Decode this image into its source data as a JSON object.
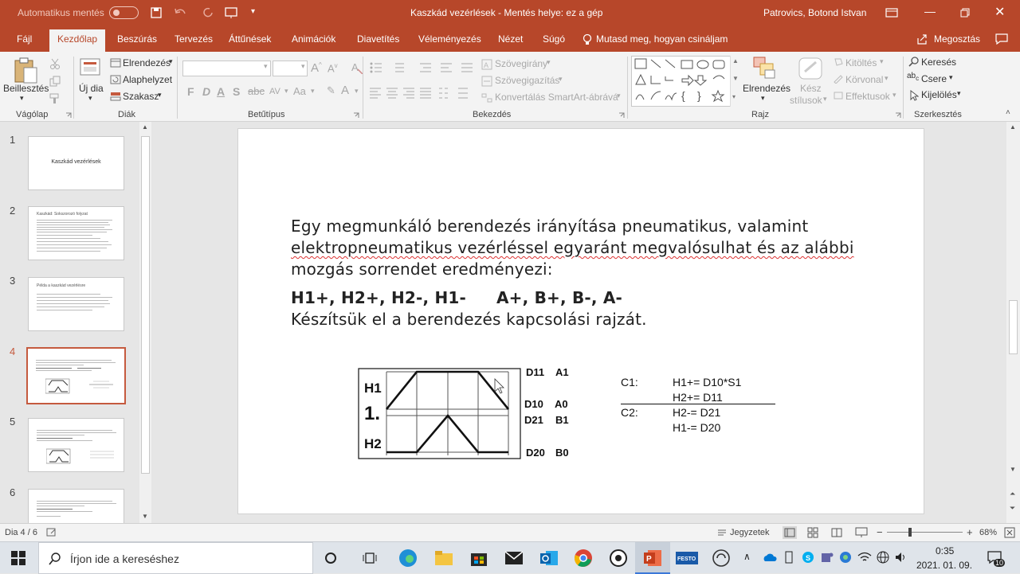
{
  "title_bar": {
    "autosave_label": "Automatikus mentés",
    "autosave_state": "Ki",
    "document_title": "Kaszkád vezérlések  -  Mentés helye: ez a gép",
    "user_name": "Patrovics, Botond Istvan"
  },
  "ribbon_tabs": [
    "Fájl",
    "Kezdőlap",
    "Beszúrás",
    "Tervezés",
    "Áttűnések",
    "Animációk",
    "Diavetítés",
    "Véleményezés",
    "Nézet",
    "Súgó"
  ],
  "tell_me": "Mutasd meg, hogyan csináljam",
  "share_label": "Megosztás",
  "ribbon": {
    "clipboard": {
      "paste": "Beillesztés",
      "group": "Vágólap"
    },
    "slides": {
      "new_slide": "Új dia",
      "layout": "Elrendezés",
      "reset": "Alaphelyzet",
      "section": "Szakasz",
      "group": "Diák"
    },
    "font": {
      "bold": "F",
      "italic": "D",
      "underline": "A",
      "strike": "S",
      "group": "Betűtípus"
    },
    "paragraph": {
      "text_direction": "Szövegirány",
      "align_text": "Szövegigazítás",
      "smartart": "Konvertálás SmartArt-ábrává",
      "group": "Bekezdés"
    },
    "drawing": {
      "arrange": "Elrendezés",
      "quick_styles_1": "Kész",
      "quick_styles_2": "stílusok",
      "fill": "Kitöltés",
      "outline": "Körvonal",
      "effects": "Effektusok",
      "group": "Rajz"
    },
    "editing": {
      "find": "Keresés",
      "replace": "Csere",
      "select": "Kijelölés",
      "group": "Szerkesztés"
    }
  },
  "thumbnails": [
    {
      "num": "1",
      "title": "Kaszkád vezérlések"
    },
    {
      "num": "2",
      "title": "Kaszkád: Sokszorozó folyzat"
    },
    {
      "num": "3",
      "title": "Példa a kaszkád vezérlésre"
    },
    {
      "num": "4",
      "title": ""
    },
    {
      "num": "5",
      "title": ""
    },
    {
      "num": "6",
      "title": ""
    }
  ],
  "slide": {
    "para_line1": "Egy megmunkáló berendezés irányítása pneumatikus, valamint",
    "para_line2": "elektropneumatikus vezérléssel egyaránt megvalósulhat és az alábbi",
    "para_line3": "mozgás sorrendet eredményezi:",
    "sequence_h": "H1+, H2+, H2-, H1-",
    "sequence_ab": "A+, B+, B-, A-",
    "task_line": "Készítsük el a berendezés kapcsolási rajzát.",
    "diagram": {
      "h1": "H1",
      "one": "1.",
      "h2": "H2",
      "d11": "D11",
      "a1": "A1",
      "d10": "D10",
      "a0": "A0",
      "d21": "D21",
      "b1": "B1",
      "d20": "D20",
      "b0": "B0"
    },
    "cascade": {
      "c1": "C1:",
      "c1_eq1": "H1+= D10*S1",
      "c1_eq2": "H2+= D11",
      "c2": "C2:",
      "c2_eq1": "H2-= D21",
      "c2_eq2": "H1-= D20"
    }
  },
  "status_bar": {
    "slide_pos": "Dia 4 / 6",
    "notes": "Jegyzetek",
    "zoom": "68%"
  },
  "taskbar": {
    "search_placeholder": "Írjon ide a kereséshez",
    "time": "0:35",
    "date": "2021. 01. 09.",
    "notif_count": "10"
  },
  "colors": {
    "accent": "#b7472a",
    "selected_thumb": "#c55a3e"
  }
}
